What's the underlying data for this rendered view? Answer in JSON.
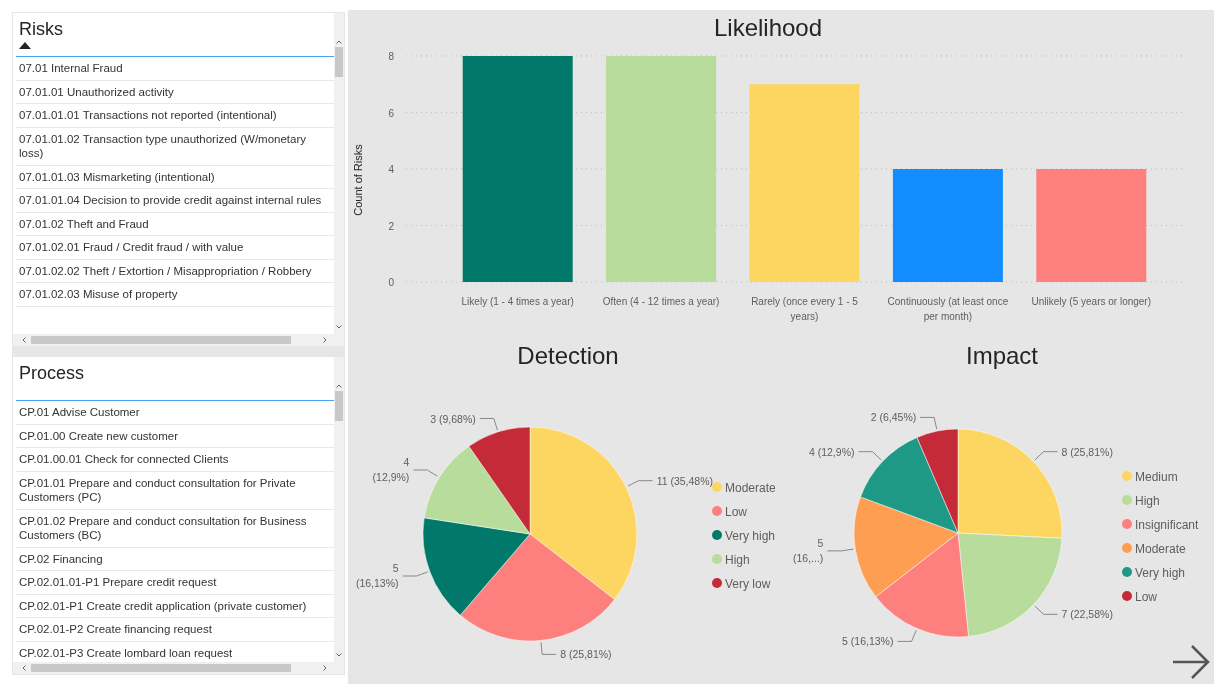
{
  "slicers": [
    {
      "title": "Risks",
      "sort_indicator": true,
      "items": [
        "07.01 Internal Fraud",
        "07.01.01 Unauthorized activity",
        "07.01.01.01 Transactions not reported (intentional)",
        "07.01.01.02 Transaction type unauthorized (W/monetary loss)",
        "07.01.01.03 Mismarketing (intentional)",
        "07.01.01.04 Decision to provide credit against internal rules",
        "07.01.02 Theft and Fraud",
        "07.01.02.01 Fraud / Credit fraud / with value",
        "07.01.02.02 Theft / Extortion / Misappropriation / Robbery",
        "07.01.02.03 Misuse of property"
      ]
    },
    {
      "title": "Process",
      "sort_indicator": false,
      "items": [
        "CP.01 Advise Customer",
        "CP.01.00 Create new customer",
        "CP.01.00.01 Check for connected Clients",
        "CP.01.01 Prepare and conduct consultation for Private Customers (PC)",
        "CP.01.02 Prepare and conduct consultation for Business Customers (BC)",
        "CP.02 Financing",
        "CP.02.01.01-P1 Prepare credit request",
        "CP.02.01-P1 Create credit application (private customer)",
        "CP.02.01-P2 Create financing request",
        "CP.02.01-P3 Create lombard loan request"
      ]
    }
  ],
  "likelihood": {
    "chart_data": {
      "type": "bar",
      "title": "Likelihood",
      "ylabel": "Count of Risks",
      "categories": [
        "Likely (1 - 4 times a year)",
        "Often (4 - 12 times a year)",
        "Rarely (once every 1 - 5 years)",
        "Continuously (at least once per month)",
        "Unlikely (5 years or longer)"
      ],
      "grid": true,
      "series": [
        {
          "colors": [
            "#01796a",
            "#b7dc9b",
            "#fdd662",
            "#118dff",
            "#fd7f7e"
          ],
          "values": [
            8,
            8,
            7,
            4,
            4
          ]
        }
      ],
      "ylim": [
        0,
        8
      ],
      "yticks": [
        0,
        2,
        4,
        6,
        8
      ]
    }
  },
  "detection": {
    "chart_data": {
      "type": "pie",
      "title": "Detection",
      "categories": [
        "Moderate",
        "Low",
        "Very high",
        "High",
        "Very low"
      ],
      "values": [
        11,
        8,
        5,
        4,
        3
      ],
      "colors": [
        "#fdd662",
        "#fd7f7e",
        "#01796a",
        "#b7dc9b",
        "#c42a37"
      ],
      "legend": true,
      "value_labels": [
        "11 (35,48%)",
        "8 (25,81%)",
        "5 (16,13%)",
        "4 (12,9%)",
        "3 (9,68%)"
      ]
    }
  },
  "impact": {
    "chart_data": {
      "type": "pie",
      "title": "Impact",
      "categories": [
        "Medium",
        "High",
        "Insignificant",
        "Moderate",
        "Very high",
        "Low"
      ],
      "values": [
        8,
        7,
        5,
        5,
        4,
        2
      ],
      "colors": [
        "#fdd662",
        "#b7dc9b",
        "#fd7f7e",
        "#fd9e52",
        "#1e9985",
        "#c42a37"
      ],
      "legend": true,
      "value_labels": [
        "8 (25,81%)",
        "7 (22,58%)",
        "5 (16,13%)",
        "5 (16,...)",
        "4 (12,9%)",
        "2 (6,45%)"
      ]
    }
  }
}
